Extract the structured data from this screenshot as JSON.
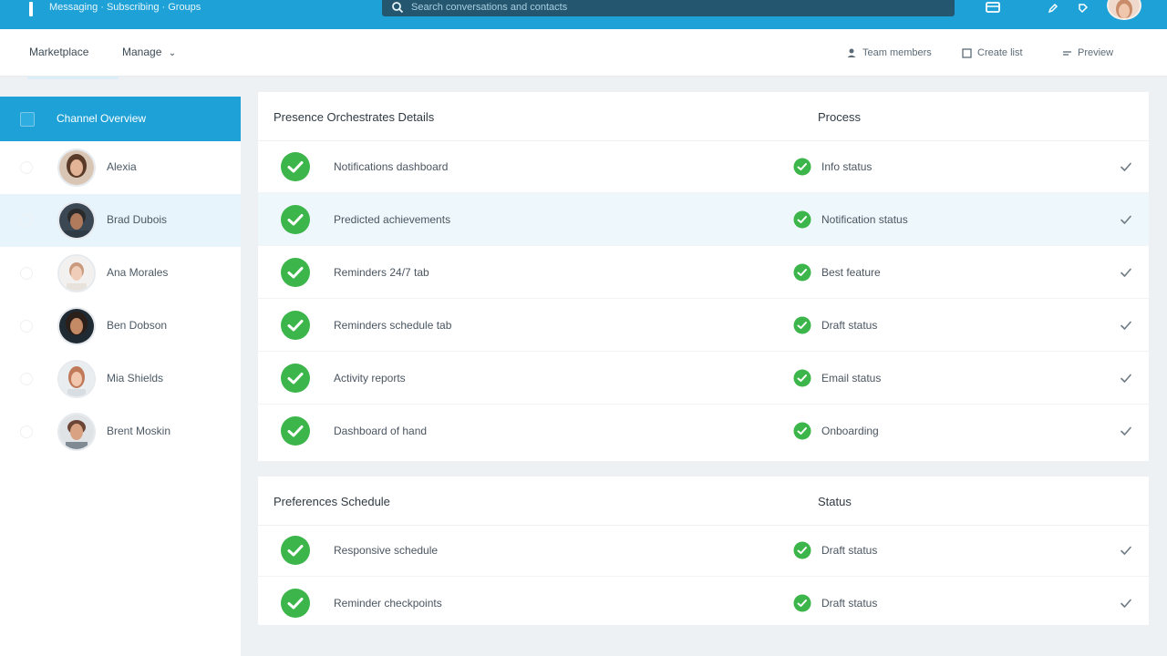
{
  "header": {
    "brand_text": "Messaging · Subscribing · Groups",
    "search_placeholder": "Search conversations and contacts"
  },
  "subbar": {
    "nav": [
      "Marketplace",
      "Manage"
    ],
    "actions": [
      "Team members",
      "Create list",
      "Preview"
    ]
  },
  "sidebar": {
    "header_label": "Channel Overview",
    "items": [
      {
        "name": "Alexia"
      },
      {
        "name": "Brad Dubois"
      },
      {
        "name": "Ana Morales"
      },
      {
        "name": "Ben Dobson"
      },
      {
        "name": "Mia Shields"
      },
      {
        "name": "Brent Moskin"
      }
    ]
  },
  "card1": {
    "col1_title": "Presence Orchestrates Details",
    "col2_title": "Process",
    "rows": [
      {
        "label": "Notifications dashboard",
        "status": "Info status"
      },
      {
        "label": "Predicted achievements",
        "status": "Notification status"
      },
      {
        "label": "Reminders 24/7 tab",
        "status": "Best feature"
      },
      {
        "label": "Reminders schedule tab",
        "status": "Draft status"
      },
      {
        "label": "Activity reports",
        "status": "Email status"
      },
      {
        "label": "Dashboard of hand",
        "status": "Onboarding"
      }
    ]
  },
  "card2": {
    "col1_title": "Preferences Schedule",
    "col2_title": "Status",
    "rows": [
      {
        "label": "Responsive schedule",
        "status": "Draft status"
      },
      {
        "label": "Reminder checkpoints",
        "status": "Draft status"
      }
    ]
  },
  "colors": {
    "primary": "#1ea1d6",
    "success": "#3cb54a",
    "highlight_row": "#eef7fc"
  },
  "icons": [
    "search-icon",
    "window-icon",
    "pencil-icon",
    "tag-icon",
    "user-icon",
    "list-icon",
    "preview-icon",
    "check-circle-icon",
    "checkmark-icon"
  ]
}
